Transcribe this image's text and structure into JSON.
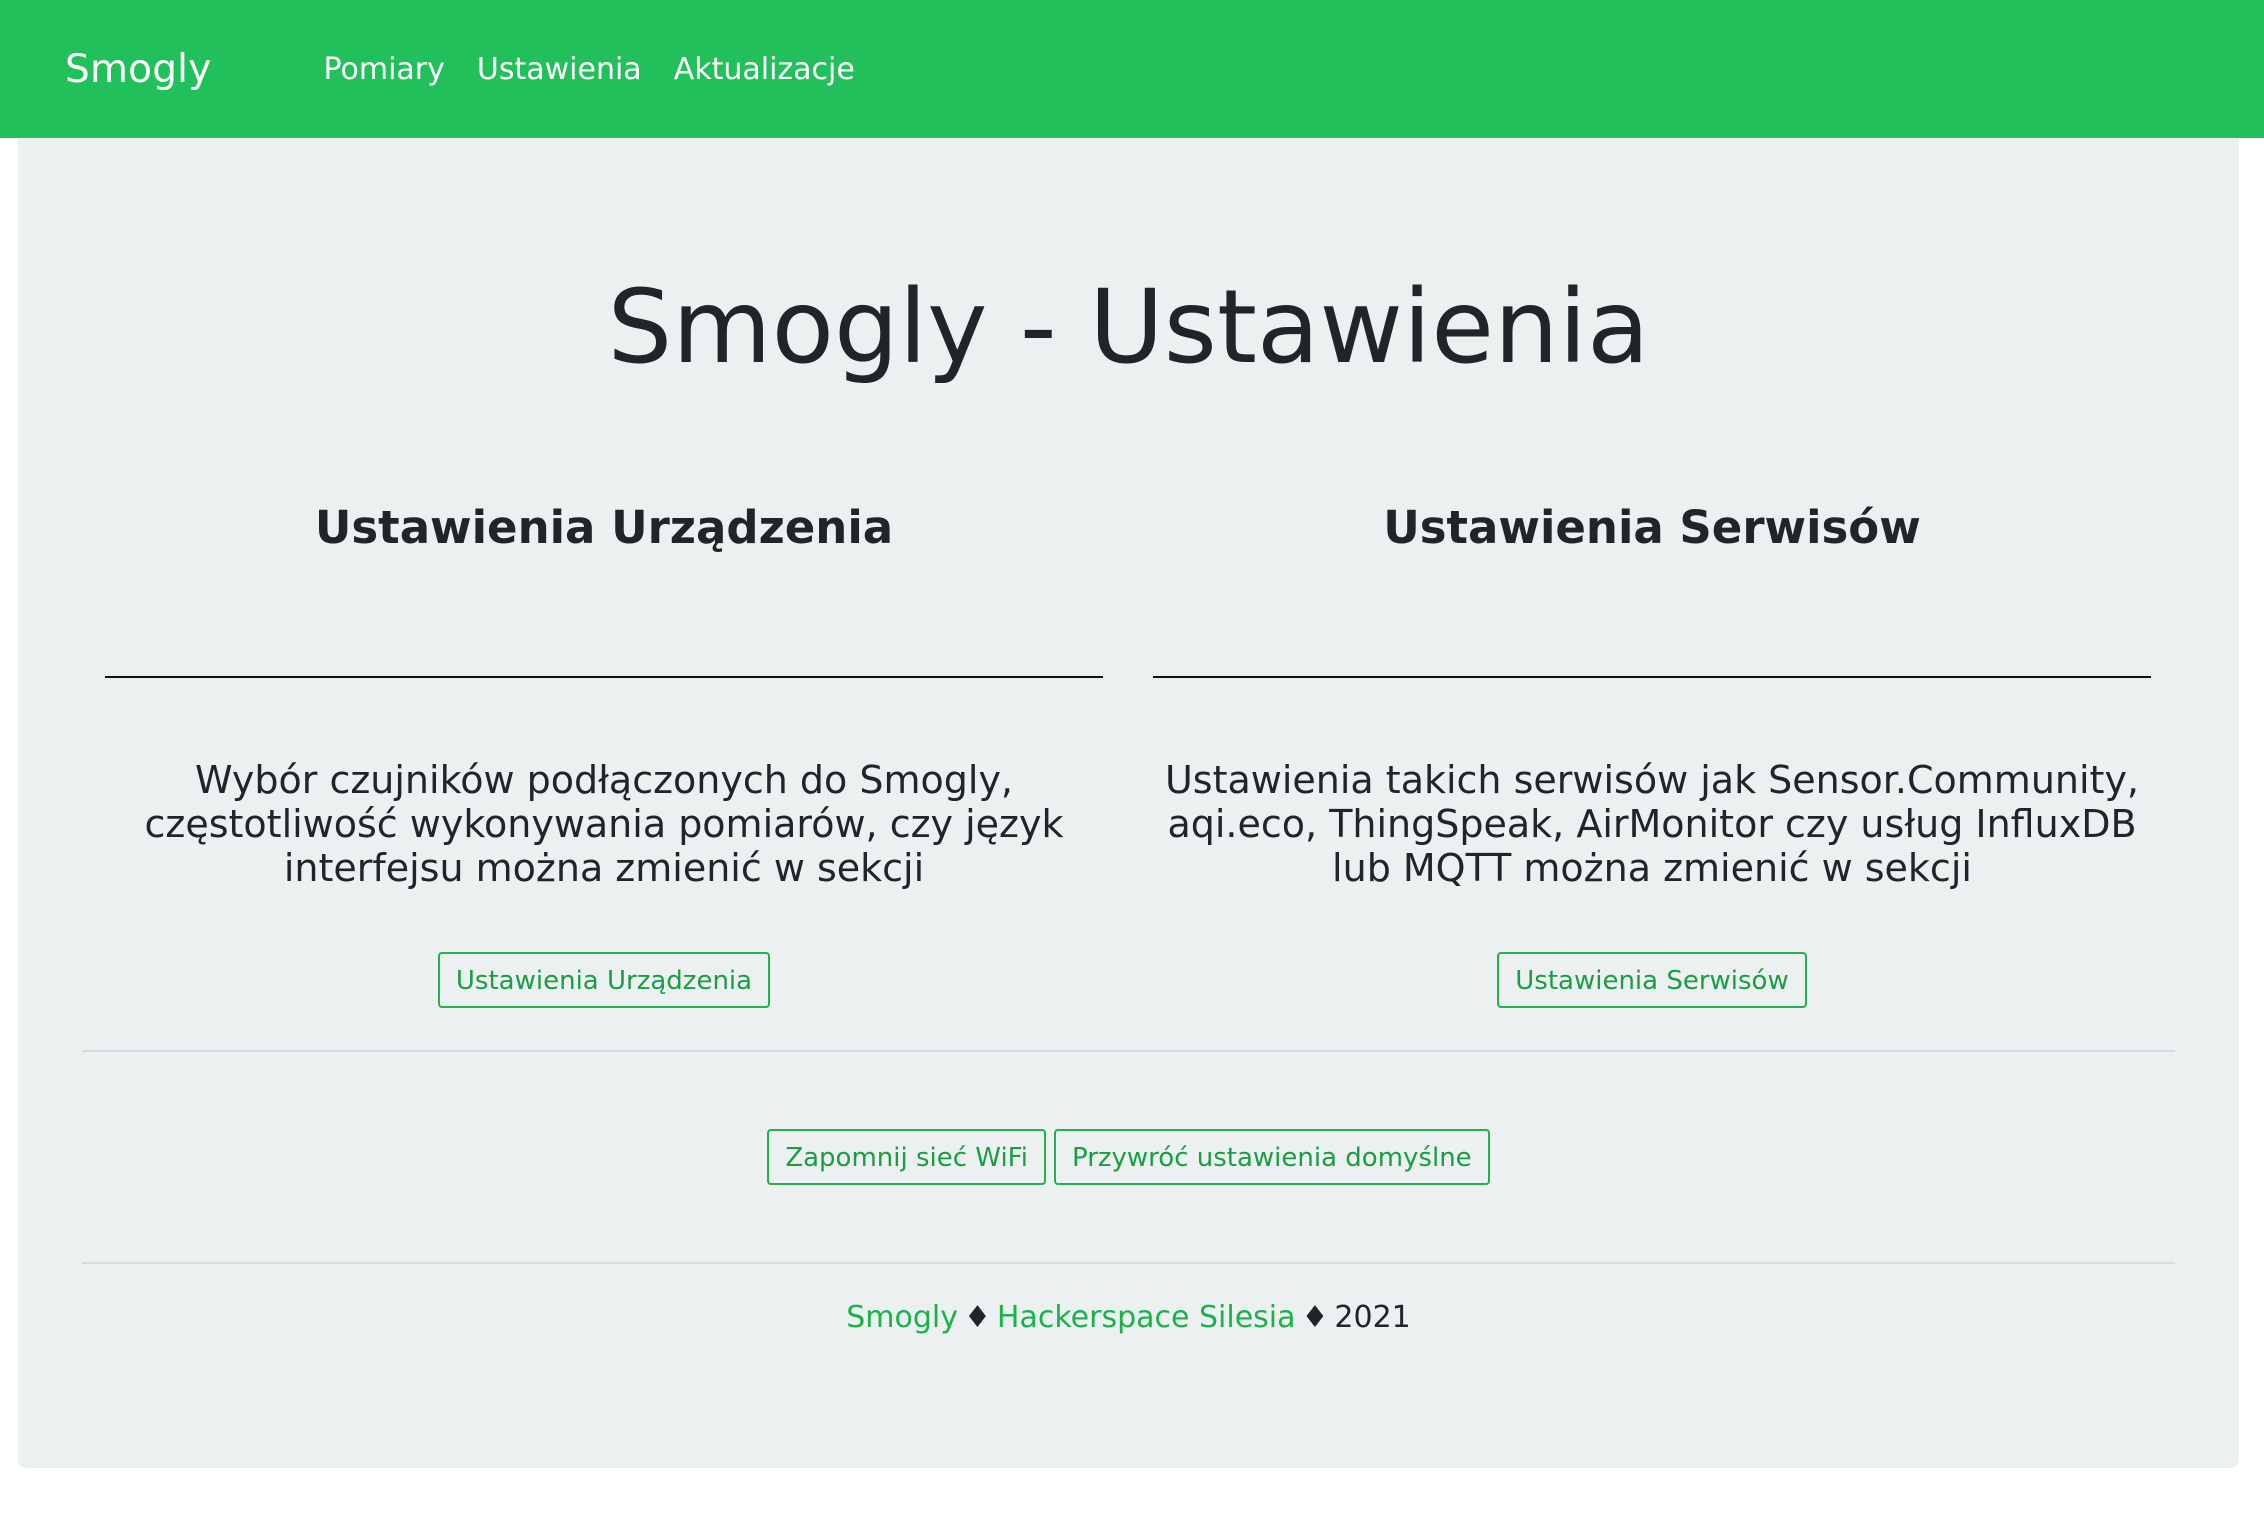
{
  "navbar": {
    "brand": "Smogly",
    "links": [
      "Pomiary",
      "Ustawienia",
      "Aktualizacje"
    ],
    "background": "#22c05a"
  },
  "main": {
    "title": "Smogly - Ustawienia",
    "columns": [
      {
        "heading": "Ustawienia Urządzenia",
        "description": "Wybór czujników podłączonych do Smogly, częstotliwość wykonywania pomiarów, czy język interfejsu można zmienić w sekcji",
        "button_label": "Ustawienia Urządzenia"
      },
      {
        "heading": "Ustawienia Serwisów",
        "description": "Ustawienia takich serwisów jak Sensor.Community, aqi.eco, ThingSpeak, AirMonitor czy usług InfluxDB lub MQTT można zmienić w sekcji",
        "button_label": "Ustawienia Serwisów"
      }
    ],
    "actions": {
      "forget_wifi_label": "Zapomnij sieć WiFi",
      "restore_defaults_label": "Przywróć ustawienia domyślne"
    }
  },
  "footer": {
    "link1": "Smogly",
    "separator": "♦",
    "link2": "Hackerspace Silesia",
    "year": "2021"
  },
  "colors": {
    "accent": "#22c05a",
    "card_background": "#ecf0f1",
    "button_border": "#22b14c"
  }
}
